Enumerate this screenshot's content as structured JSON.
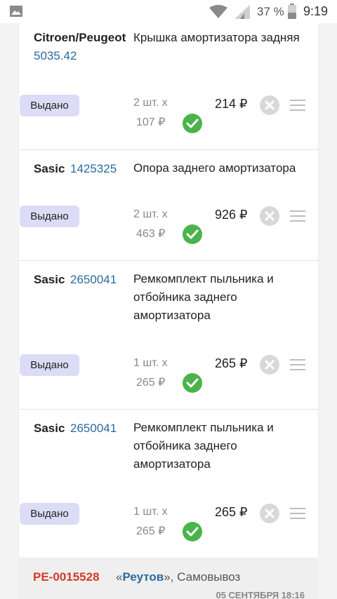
{
  "status_bar": {
    "battery_percent": "37 %",
    "time": "9:19",
    "icons": [
      "image-icon",
      "wifi-icon",
      "signal-icon",
      "battery-icon"
    ]
  },
  "items": [
    {
      "brand": "Citroen/Peugeot",
      "article": "5035.42",
      "name": "Крышка амортизатора задняя",
      "status": "Выдано",
      "qty": "2 шт. x",
      "unit_price": "107 ₽",
      "total": "214 ₽"
    },
    {
      "brand": "Sasic",
      "article": "1425325",
      "name": "Опора заднего амортизатора",
      "status": "Выдано",
      "qty": "2 шт. x",
      "unit_price": "463 ₽",
      "total": "926 ₽"
    },
    {
      "brand": "Sasic",
      "article": "2650041",
      "name": "Ремкомплект пыльника и отбойника заднего амортизатора",
      "status": "Выдано",
      "qty": "1 шт. x",
      "unit_price": "265 ₽",
      "total": "265 ₽"
    },
    {
      "brand": "Sasic",
      "article": "2650041",
      "name": "Ремкомплект пыльника и отбойника заднего амортизатора",
      "status": "Выдано",
      "qty": "1 шт. x",
      "unit_price": "265 ₽",
      "total": "265 ₽"
    }
  ],
  "order": {
    "number": "РЕ-0015528",
    "quote_open": "«",
    "city": "Реутов",
    "quote_close": "»,",
    "delivery": "Самовывоз",
    "date": "05 СЕНТЯБРЯ 18:16"
  },
  "colors": {
    "badge_bg": "#dcdcf7",
    "check_green": "#4bb34b",
    "article_blue": "#2a6a9e",
    "order_red": "#d23a2a"
  }
}
